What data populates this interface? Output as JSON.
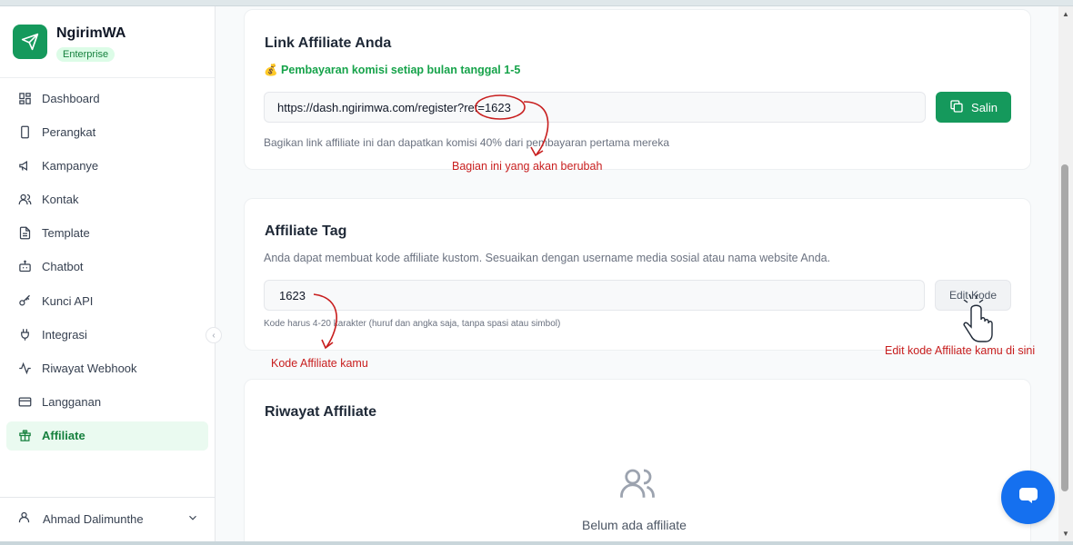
{
  "app": {
    "name": "NgirimWA",
    "plan": "Enterprise"
  },
  "sidebar": {
    "items": [
      {
        "label": "Dashboard",
        "icon": "grid-icon"
      },
      {
        "label": "Perangkat",
        "icon": "phone-icon"
      },
      {
        "label": "Kampanye",
        "icon": "megaphone-icon"
      },
      {
        "label": "Kontak",
        "icon": "users-icon"
      },
      {
        "label": "Template",
        "icon": "file-text-icon"
      },
      {
        "label": "Chatbot",
        "icon": "bot-icon"
      },
      {
        "label": "Kunci API",
        "icon": "key-icon"
      },
      {
        "label": "Integrasi",
        "icon": "plug-icon"
      },
      {
        "label": "Riwayat Webhook",
        "icon": "activity-icon"
      },
      {
        "label": "Langganan",
        "icon": "credit-card-icon"
      },
      {
        "label": "Affiliate",
        "icon": "gift-icon",
        "active": true
      }
    ],
    "user": {
      "name": "Ahmad Dalimunthe"
    }
  },
  "link_card": {
    "title": "Link Affiliate Anda",
    "notice": "💰 Pembayaran komisi setiap bulan tanggal 1-5",
    "link_value": "https://dash.ngirimwa.com/register?ref=1623",
    "copy_label": "Salin",
    "helper": "Bagikan link affiliate ini dan dapatkan komisi 40% dari pembayaran pertama mereka"
  },
  "tag_card": {
    "title": "Affiliate Tag",
    "description": "Anda dapat membuat kode affiliate kustom. Sesuaikan dengan username media sosial atau nama website Anda.",
    "code_value": "1623",
    "edit_label": "Edit Kode",
    "helper": "Kode harus 4-20 karakter (huruf dan angka saja, tanpa spasi atau simbol)"
  },
  "history_card": {
    "title": "Riwayat Affiliate",
    "empty_text": "Belum ada affiliate"
  },
  "annotations": {
    "link_note": "Bagian ini yang akan berubah",
    "code_note": "Kode Affiliate kamu",
    "edit_note": "Edit kode Affiliate kamu di sini"
  },
  "colors": {
    "brand": "#15995c",
    "annotation": "#c81e1e",
    "chat": "#1570ef"
  }
}
